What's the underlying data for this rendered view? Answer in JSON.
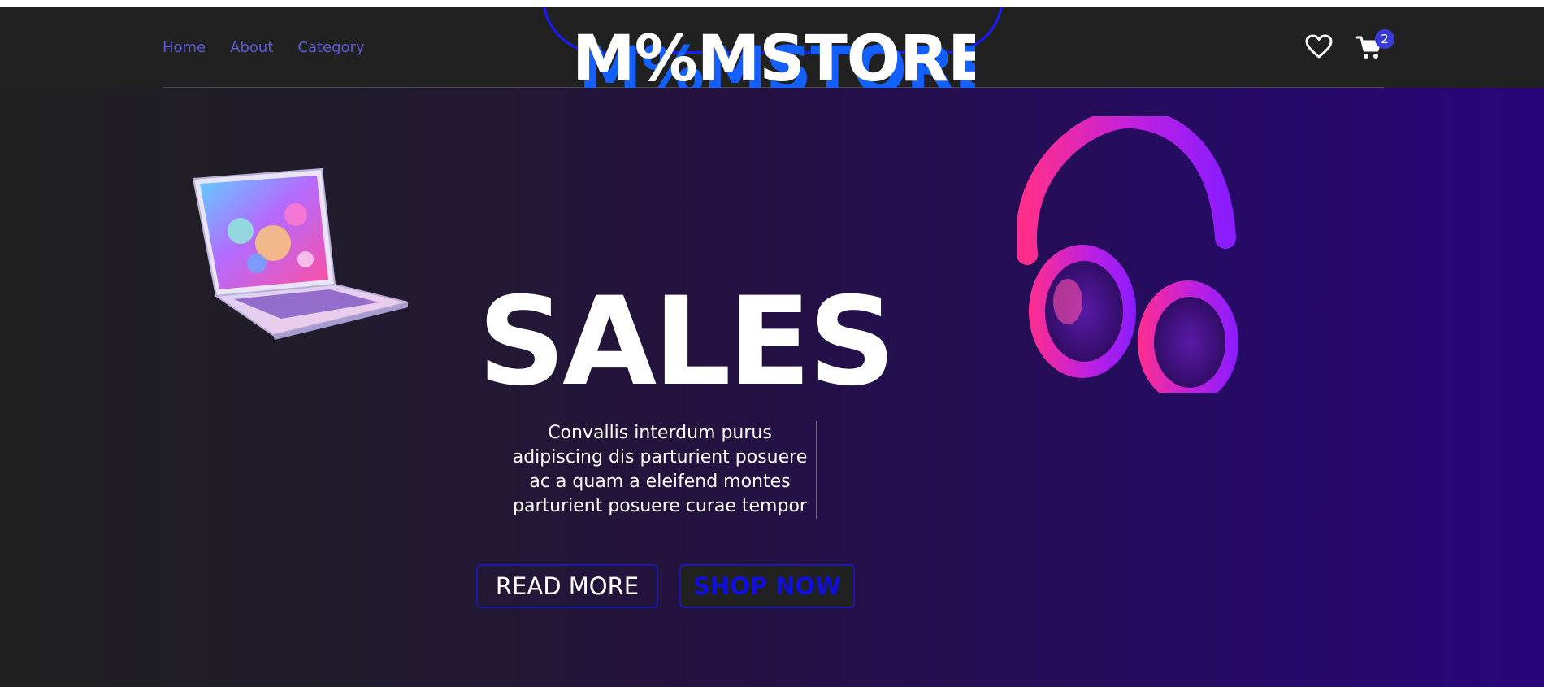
{
  "nav": {
    "links": [
      "Home",
      "About",
      "Category"
    ]
  },
  "logo": {
    "text": "M%MSTORE"
  },
  "header": {
    "wishlist_icon": "heart-icon",
    "cart_icon": "cart-icon",
    "cart_count": "2"
  },
  "hero": {
    "title": "SALES",
    "description": "Convallis interdum purus adipiscing dis parturient posuere ac a quam a eleifend montes parturient posuere curae tempor",
    "read_more_label": "READ MORE",
    "shop_now_label": "SHOP NOW"
  },
  "colors": {
    "nav_link": "#5b5bd6",
    "accent_blue": "#1a1aff",
    "badge": "#3a3ad6",
    "gradient_end": "#28067a"
  }
}
